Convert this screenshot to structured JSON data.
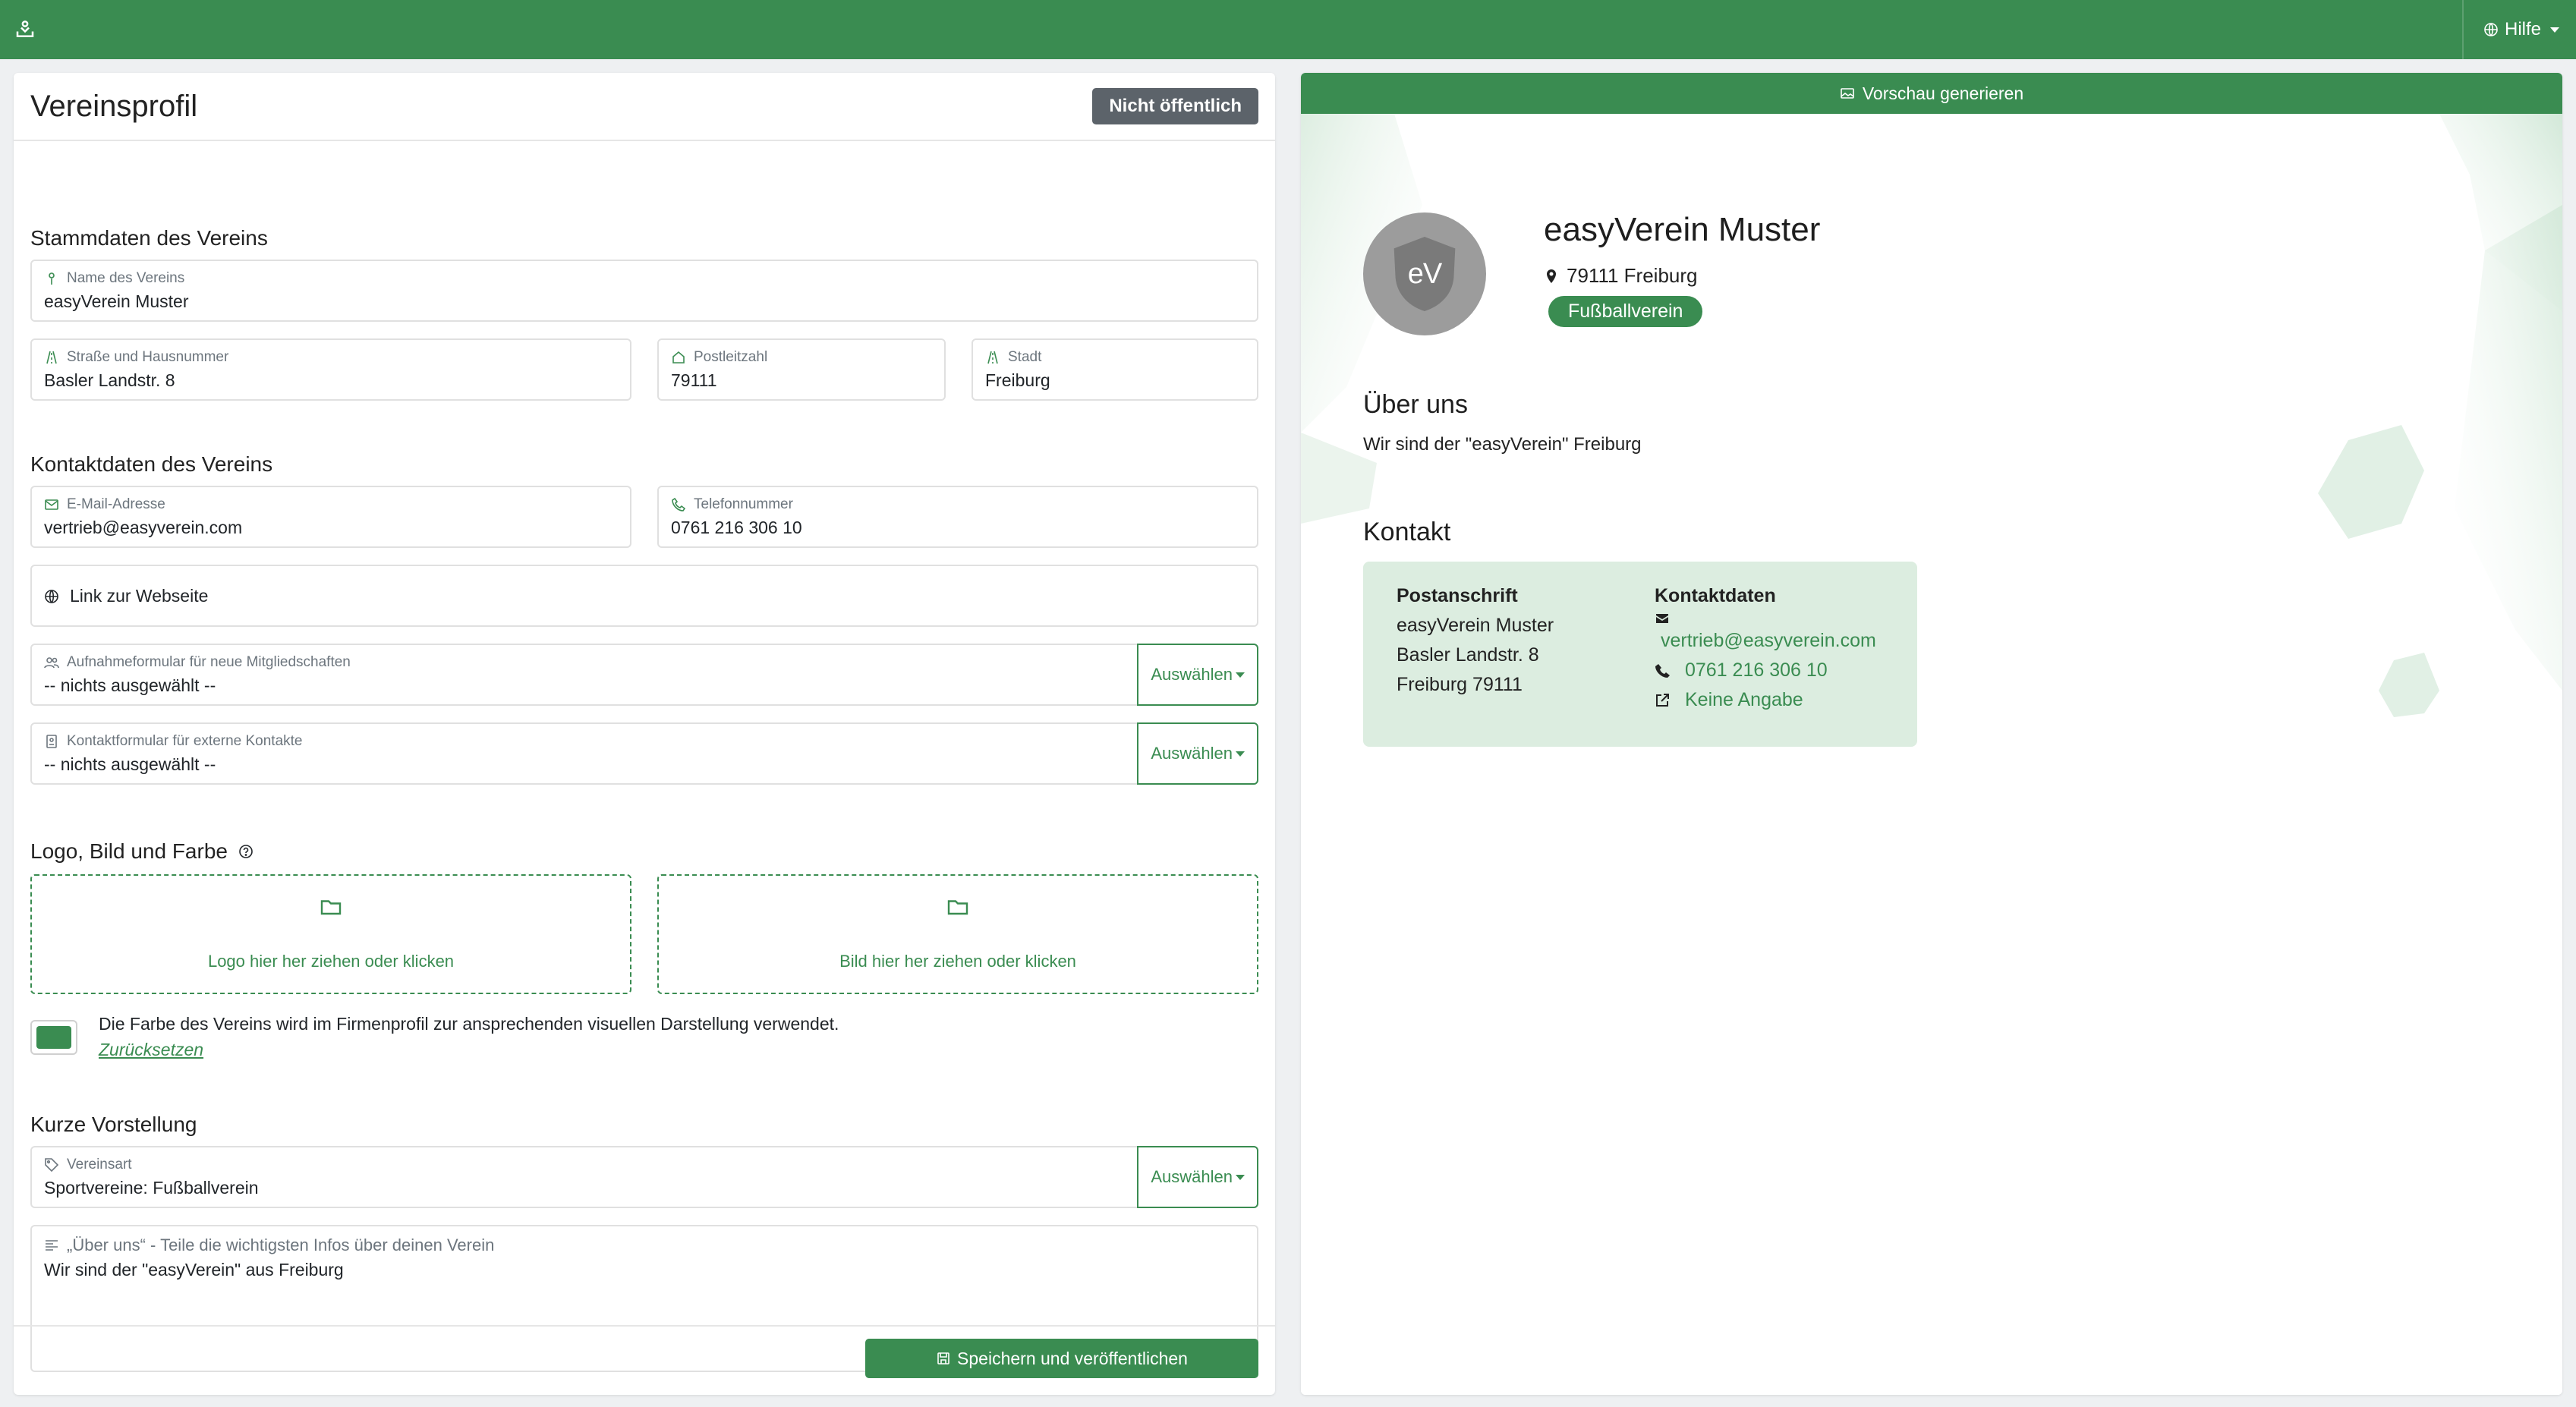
{
  "nav": {
    "help_label": "Hilfe"
  },
  "left": {
    "title": "Vereinsprofil",
    "status_badge": "Nicht öffentlich",
    "stammdaten": {
      "title": "Stammdaten des Vereins",
      "name": {
        "label": "Name des Vereins",
        "value": "easyVerein Muster"
      },
      "street": {
        "label": "Straße und Hausnummer",
        "value": "Basler Landstr. 8"
      },
      "zip": {
        "label": "Postleitzahl",
        "value": "79111"
      },
      "city": {
        "label": "Stadt",
        "value": "Freiburg"
      }
    },
    "kontakt": {
      "title": "Kontaktdaten des Vereins",
      "email": {
        "label": "E-Mail-Adresse",
        "value": "vertrieb@easyverein.com"
      },
      "phone": {
        "label": "Telefonnummer",
        "value": "0761 216 306 10"
      },
      "website_placeholder": "Link zur Webseite",
      "membership_form": {
        "label": "Aufnahmeformular für neue Mitgliedschaften",
        "value": "-- nichts ausgewählt --",
        "button": "Auswählen"
      },
      "contact_form": {
        "label": "Kontaktformular für externe Kontakte",
        "value": "-- nichts ausgewählt --",
        "button": "Auswählen"
      }
    },
    "media": {
      "title": "Logo, Bild und Farbe",
      "logo_drop": "Logo hier her ziehen oder klicken",
      "image_drop": "Bild hier her ziehen oder klicken",
      "color_text": "Die Farbe des Vereins wird im Firmenprofil zur ansprechenden visuellen Darstellung verwendet.",
      "reset_link": "Zurücksetzen",
      "color": "#3a8c51"
    },
    "intro": {
      "title": "Kurze Vorstellung",
      "type": {
        "label": "Vereinsart",
        "value": "Sportvereine: Fußballverein",
        "button": "Auswählen"
      },
      "about": {
        "label": "„Über uns“ - Teile die wichtigsten Infos über deinen Verein",
        "value": "Wir sind der \"easyVerein\" aus Freiburg"
      }
    },
    "save_button": "Speichern und veröffentlichen"
  },
  "preview": {
    "generate_button": "Vorschau generieren",
    "name": "easyVerein Muster",
    "location": "79111 Freiburg",
    "category": "Fußballverein",
    "about_title": "Über uns",
    "about_text": "Wir sind der \"easyVerein\" Freiburg",
    "contact_title": "Kontakt",
    "postal": {
      "title": "Postanschrift",
      "line1": "easyVerein Muster",
      "line2": "Basler Landstr. 8",
      "line3": "Freiburg 79111"
    },
    "contact": {
      "title": "Kontaktdaten",
      "email": "vertrieb@easyverein.com",
      "phone": "0761 216 306 10",
      "website": "Keine Angabe"
    },
    "avatar_text": "eV"
  },
  "colors": {
    "brand": "#3a8c51",
    "brand_light": "#dcede0"
  }
}
